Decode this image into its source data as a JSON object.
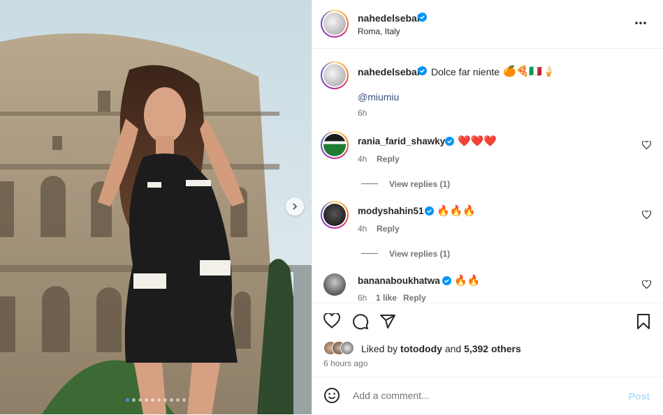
{
  "post": {
    "author": "nahedelsebai",
    "location": "Roma, Italy",
    "caption": "Dolce far niente",
    "caption_emojis": "🍊🍕🇮🇹🍦",
    "mention": "@miumiu",
    "time": "6h"
  },
  "comments": [
    {
      "user": "rania_farid_shawky",
      "text": "❤️❤️❤️",
      "time": "4h",
      "reply_label": "Reply",
      "view_replies": "View replies (1)"
    },
    {
      "user": "modyshahin51",
      "text": "🔥🔥🔥",
      "time": "4h",
      "reply_label": "Reply",
      "view_replies": "View replies (1)"
    },
    {
      "user": "bananaboukhatwa",
      "text": "🔥🔥",
      "time": "6h",
      "likes": "1 like",
      "reply_label": "Reply"
    }
  ],
  "likes": {
    "prefix": "Liked by",
    "first_user": "totodody",
    "joiner": "and",
    "others": "5,392 others",
    "time_ago": "6 hours ago"
  },
  "comment_box": {
    "placeholder": "Add a comment...",
    "post_label": "Post"
  },
  "carousel": {
    "count": 10,
    "active": 0
  },
  "colors": {
    "verified": "#0095f6",
    "heart_red": "#ed4956",
    "post_disabled": "#b2dffc"
  },
  "icons": [
    "more-options-icon",
    "heart-icon",
    "comment-icon",
    "share-icon",
    "bookmark-icon",
    "emoji-icon",
    "next-arrow-icon",
    "verified-badge-icon"
  ]
}
